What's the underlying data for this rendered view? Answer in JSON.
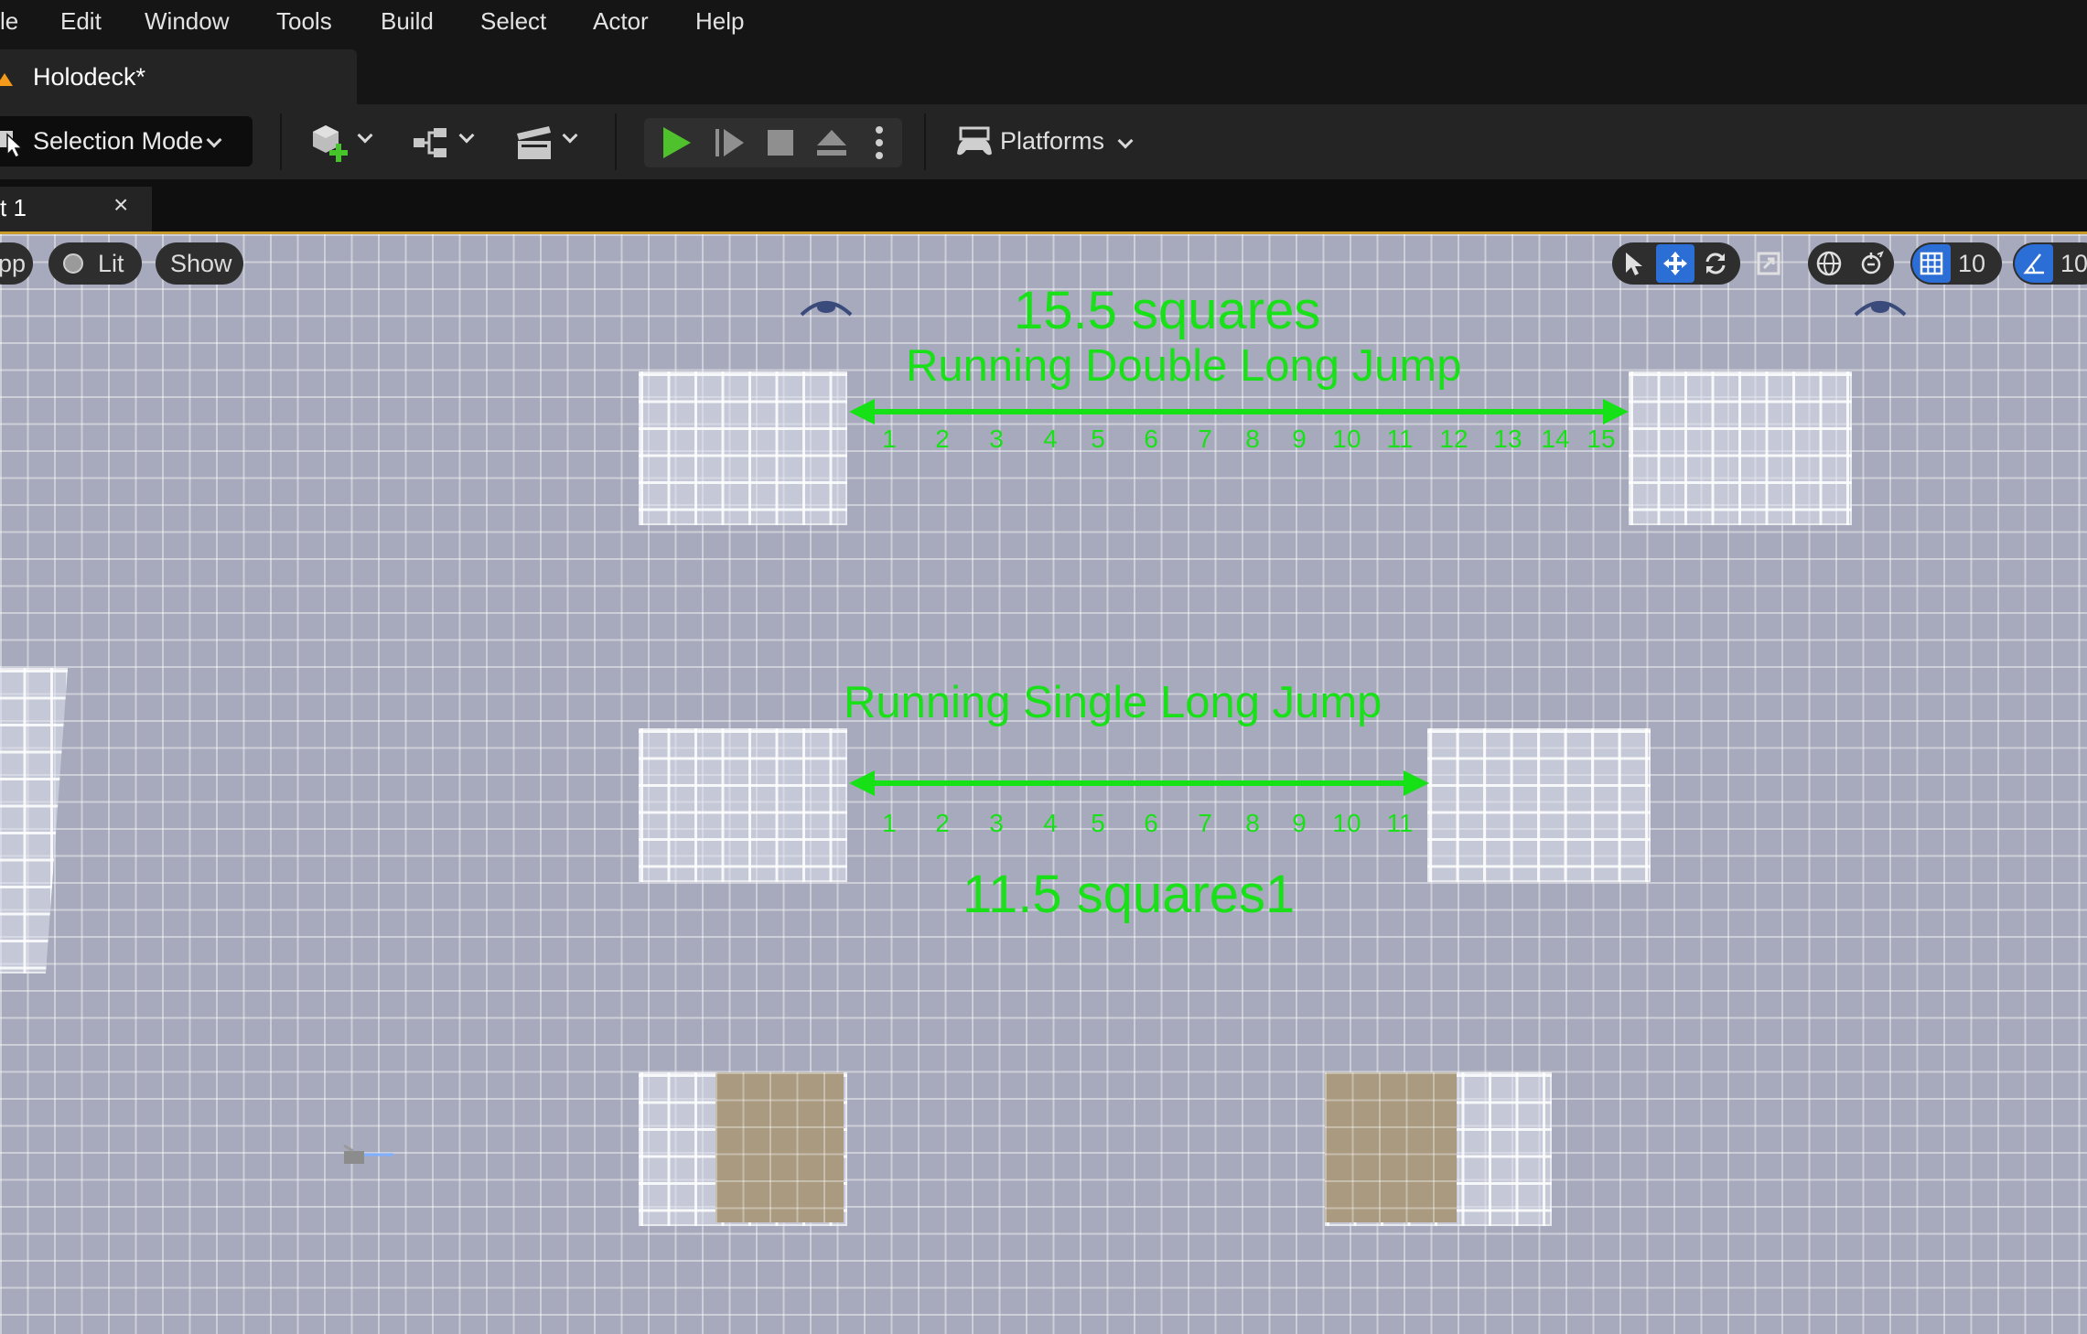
{
  "menu": {
    "items": [
      "le",
      "Edit",
      "Window",
      "Tools",
      "Build",
      "Select",
      "Actor",
      "Help"
    ]
  },
  "document_tab": {
    "title": "Holodeck*",
    "icon": "unreal-level-icon"
  },
  "toolbar": {
    "selection_mode_label": "Selection Mode",
    "platforms_label": "Platforms",
    "icons": [
      "add-actor-icon",
      "blueprint-icon",
      "cinematics-icon",
      "play-icon",
      "advance-frame-icon",
      "stop-icon",
      "eject-icon",
      "more-options-icon",
      "platforms-gamepad-icon"
    ]
  },
  "viewport_tab": {
    "label": "t 1",
    "close_label": "×"
  },
  "viewport_toolbar": {
    "left_buttons": [
      "pp",
      "Lit",
      "Show"
    ],
    "grid_snap_value": "10",
    "rotation_snap_value": "10"
  },
  "annotations": {
    "double_jump_distance": "15.5 squares",
    "double_jump_title": "Running Double Long Jump",
    "double_jump_ruler": [
      "1",
      "2",
      "3",
      "4",
      "5",
      "6",
      "7",
      "8",
      "9",
      "10",
      "11",
      "12",
      "13",
      "14",
      "15"
    ],
    "single_jump_title": "Running Single Long Jump",
    "single_jump_ruler": [
      "1",
      "2",
      "3",
      "4",
      "5",
      "6",
      "7",
      "8",
      "9",
      "10",
      "11"
    ],
    "single_jump_distance": "11.5 squares1"
  },
  "colors": {
    "annotation_green": "#19e019",
    "accent_blue": "#2b6fd6",
    "play_green": "#4fc12d",
    "viewport_bg": "#a7aabc"
  }
}
